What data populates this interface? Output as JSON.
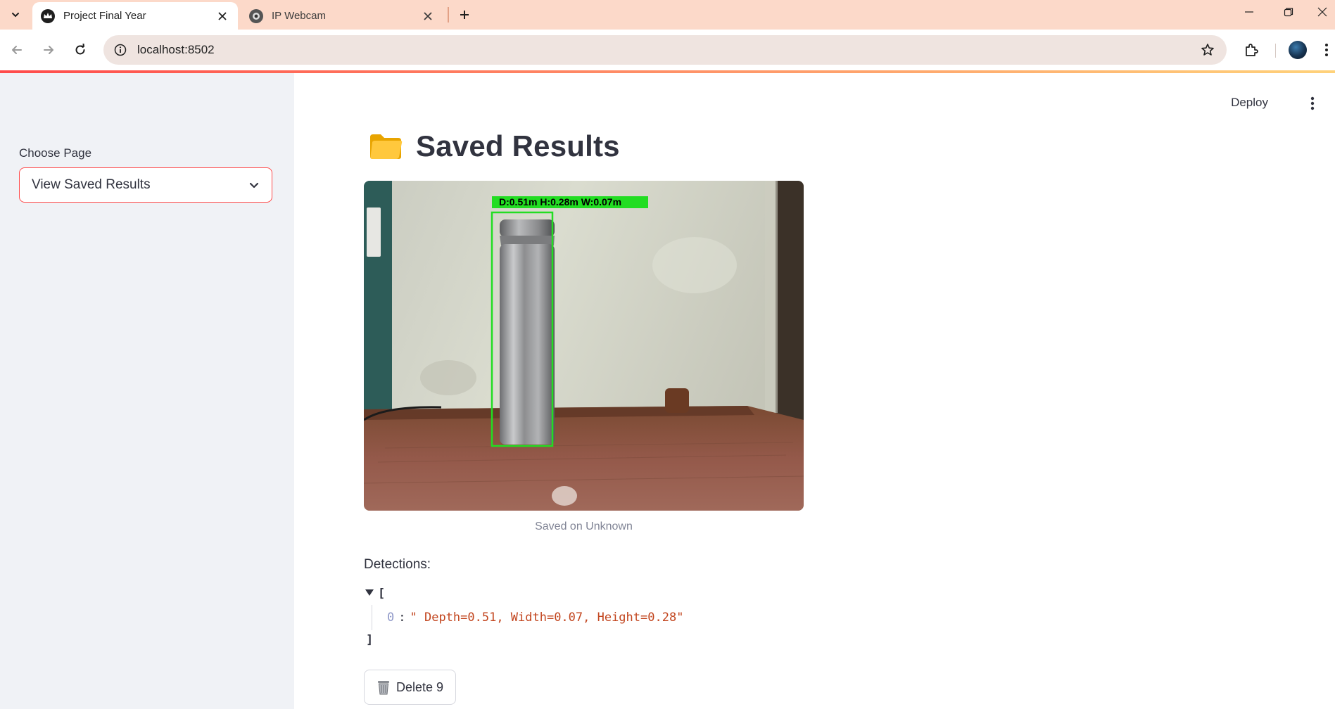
{
  "browser": {
    "tabs": [
      {
        "title": "Project Final Year",
        "active": true,
        "favicon": "streamlit-crown-icon"
      },
      {
        "title": "IP Webcam",
        "active": false,
        "favicon": "webcam-icon"
      }
    ],
    "url": "localhost:8502"
  },
  "sidebar": {
    "select_label": "Choose Page",
    "selected_page": "View Saved Results"
  },
  "header": {
    "deploy_label": "Deploy"
  },
  "main": {
    "title": "Saved Results",
    "title_icon": "folder-icon",
    "image": {
      "overlay_text": "D:0.51m  H:0.28m  W:0.07m",
      "caption": "Saved on Unknown"
    },
    "detections_label": "Detections:",
    "detections_json": {
      "open_bracket": "[",
      "close_bracket": "]",
      "items": [
        {
          "key": "0",
          "value": "\" Depth=0.51, Width=0.07, Height=0.28\""
        }
      ]
    },
    "delete_button_label": "Delete 9"
  },
  "colors": {
    "accent": "#ff4b4b",
    "sidebar_bg": "#f0f2f6",
    "tabbar_bg": "#fcd9c9",
    "bbox_green": "#22dd22",
    "json_string": "#c2451e"
  }
}
